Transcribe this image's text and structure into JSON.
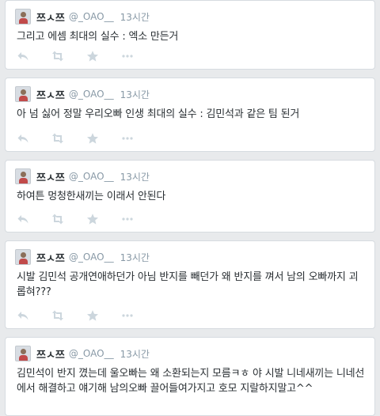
{
  "colors": {
    "background": "#e8eaec",
    "card": "#ffffff",
    "text": "#292f33",
    "meta": "#8899a6",
    "icon": "#ccd6dd"
  },
  "tweets": [
    {
      "name": "쯔ㅅ쯔",
      "handle": "@_OAO__",
      "time": "13시간",
      "text": "그리고 에셈 최대의 실수 : 엑소 만든거"
    },
    {
      "name": "쯔ㅅ쯔",
      "handle": "@_OAO__",
      "time": "13시간",
      "text": "아 넘 싫어 정말 우리오빠 인생 최대의 실수 : 김민석과 같은 팀 된거"
    },
    {
      "name": "쯔ㅅ쯔",
      "handle": "@_OAO__",
      "time": "13시간",
      "text": "하여튼 멍청한새끼는 이래서 안된다"
    },
    {
      "name": "쯔ㅅ쯔",
      "handle": "@_OAO__",
      "time": "13시간",
      "text": "시발 김민석 공개연애하던가 아님 반지를 빼던가 왜 반지를 껴서 남의 오빠까지 괴롭혀???"
    },
    {
      "name": "쯔ㅅ쯔",
      "handle": "@_OAO__",
      "time": "13시간",
      "text": "김민석이 반지 꼈는데 울오빠는 왜 소환되는지 모름ㅋㅎ 야 시발 니네새끼는 니네선에서 해결하고 얘기해 남의오빠 끌어들여가지고 호모 지랄하지말고^^"
    }
  ],
  "icons": {
    "reply": "reply-icon",
    "retweet": "retweet-icon",
    "favorite": "star-icon",
    "more": "more-icon"
  }
}
